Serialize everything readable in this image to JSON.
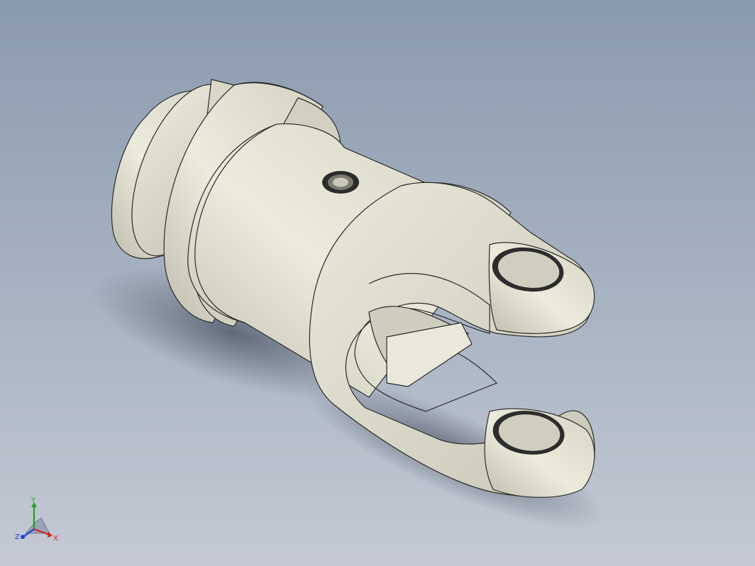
{
  "viewport": {
    "model_description_hidden": true
  },
  "colors": {
    "background_top": "#8a9aae",
    "background_bottom": "#c4c9d4",
    "part_fill": "#e6e5d6",
    "part_shade": "#b9b8a8",
    "edge": "#2a2a2a",
    "axis_x": "#d62020",
    "axis_y": "#20a020",
    "axis_z": "#2040d0"
  },
  "triad": {
    "x_label": "X",
    "y_label": "Y",
    "z_label": "Z"
  }
}
